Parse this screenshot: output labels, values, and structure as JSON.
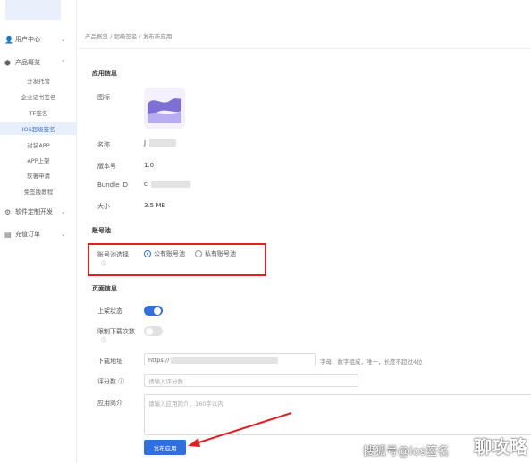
{
  "sidebar": {
    "items": [
      {
        "label": "用户中心",
        "icon": "user-icon",
        "expanded": false
      },
      {
        "label": "产品概览",
        "icon": "product-icon",
        "expanded": true
      },
      {
        "label": "软件定制开发",
        "icon": "settings-icon",
        "expanded": false
      },
      {
        "label": "充值订单",
        "icon": "order-icon",
        "expanded": false
      }
    ],
    "sub_items": [
      "分发托管",
      "企业证书签名",
      "TF签名",
      "IOS超级签名",
      "封装APP",
      "APP上架",
      "软著申请",
      "免签版教程"
    ],
    "active_sub": "IOS超级签名"
  },
  "breadcrumb": [
    "产品概览",
    "超级签名",
    "发布新应用"
  ],
  "app_info": {
    "section_title": "应用信息",
    "icon_label": "图标",
    "name_label": "名称",
    "name_value": "J",
    "version_label": "版本号",
    "version_value": "1.0",
    "bundle_label": "Bundle ID",
    "bundle_value": "c",
    "size_label": "大小",
    "size_value": "3.5 MB"
  },
  "account_pool": {
    "section_title": "账号池",
    "select_label": "账号池选择",
    "options": [
      {
        "label": "公有账号池",
        "selected": true
      },
      {
        "label": "私有账号池",
        "selected": false
      }
    ]
  },
  "page_info": {
    "section_title": "页面信息",
    "status_label": "上架状态",
    "status_on": true,
    "limit_label": "限制下载次数",
    "limit_on": false,
    "url_label": "下载地址",
    "url_value": "https://",
    "url_hint": "字母、数字组成，唯一，长度不超过4位",
    "score_label": "评分数",
    "score_placeholder": "请输入评分数",
    "intro_label": "应用简介",
    "intro_placeholder": "请输入应用简介，160字以内"
  },
  "submit_label": "发布应用",
  "watermark": {
    "text": "搜狐号@ios签名",
    "brand": "聊攻略"
  },
  "colors": {
    "primary": "#2f6fe0",
    "highlight_border": "#e02020",
    "active_bg": "#e8f0fd"
  }
}
